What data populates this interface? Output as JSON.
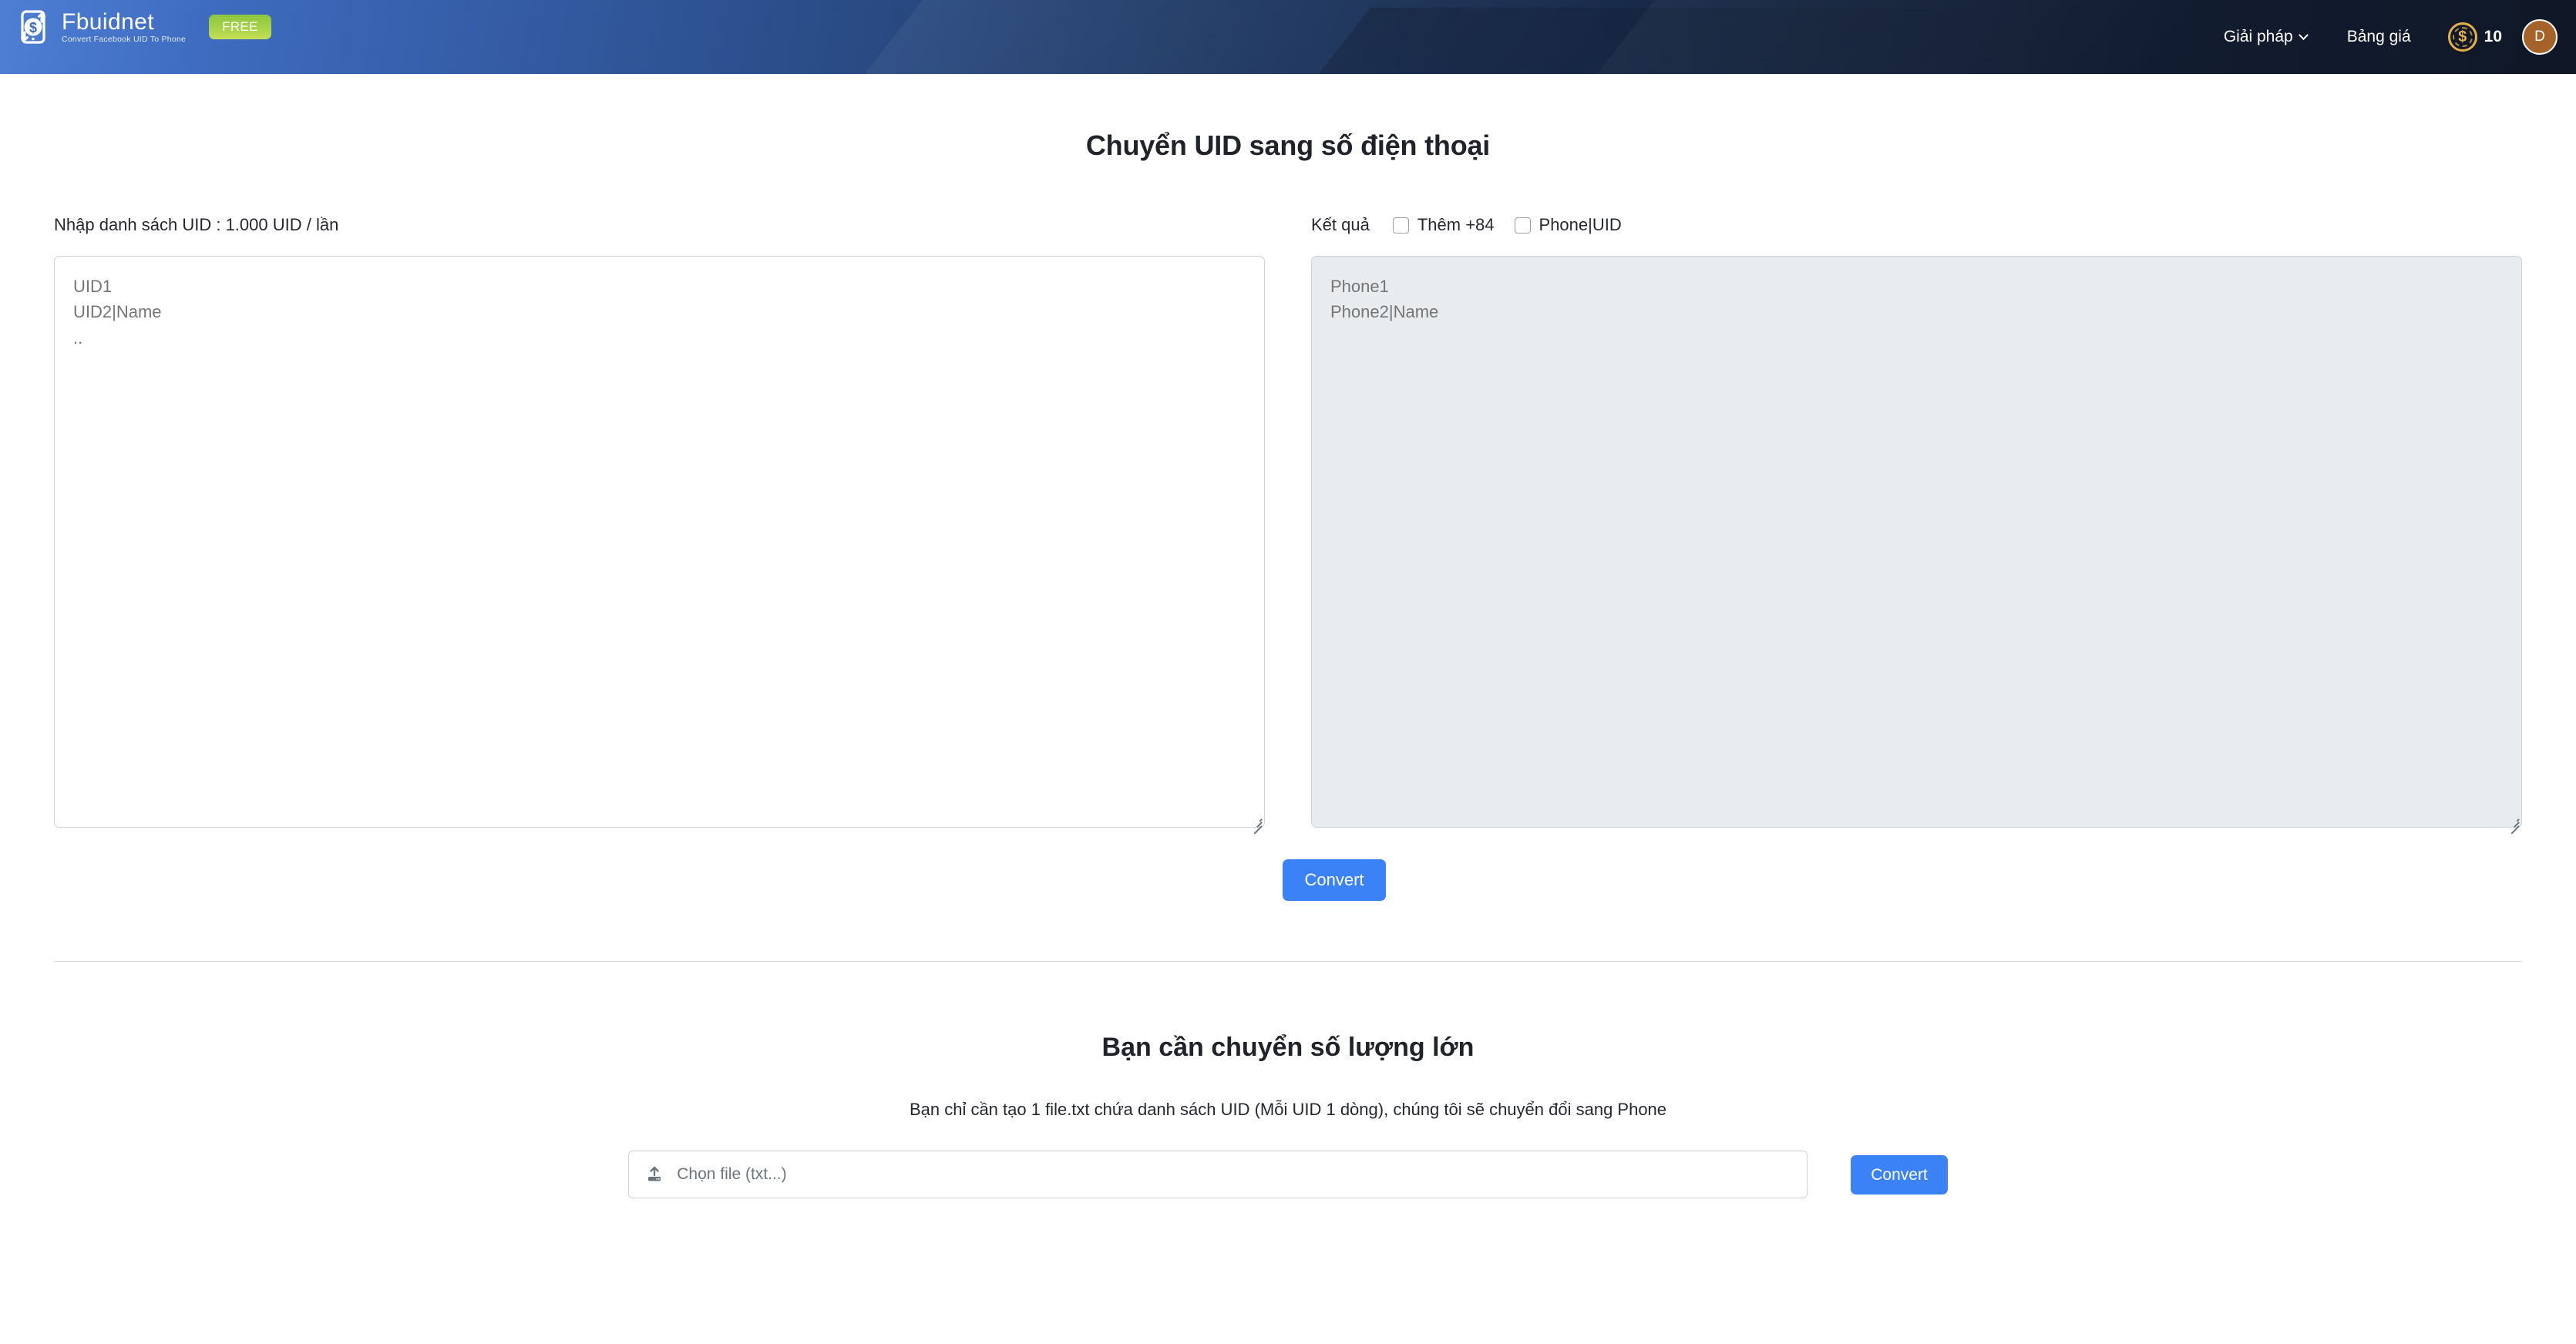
{
  "header": {
    "logo_word": "Fbuidnet",
    "logo_tagline": "Convert Facebook UID To Phone",
    "logo_icon": "dollar-phone-icon",
    "free_badge": "FREE",
    "nav": [
      {
        "label": "Giải pháp",
        "has_caret": true
      },
      {
        "label": "Bảng giá",
        "has_caret": false
      }
    ],
    "coin": {
      "icon": "coin-dollar-icon",
      "count": "10"
    },
    "avatar": {
      "initial": "D",
      "color": "#a5632a"
    }
  },
  "main": {
    "page_title": "Chuyển UID sang số điện thoại",
    "input_panel": {
      "label": "Nhập danh sách UID : 1.000 UID / lần",
      "placeholder": "UID1\nUID2|Name\n.."
    },
    "output_panel": {
      "label": "Kết quả",
      "placeholder": "Phone1\nPhone2|Name",
      "options": [
        {
          "label": "Thêm +84",
          "checked": false
        },
        {
          "label": "Phone|UID",
          "checked": false
        }
      ]
    },
    "convert_button": "Convert"
  },
  "bulk": {
    "title": "Bạn cần chuyển số lượng lớn",
    "description": "Bạn chỉ cần tạo 1 file.txt chứa danh sách UID (Mỗi UID 1 dòng), chúng tôi sẽ chuyển đổi sang Phone",
    "file_placeholder": "Chọn file (txt...)",
    "file_icon": "upload-icon",
    "convert_button": "Convert"
  },
  "colors": {
    "accent_blue": "#3b82f6",
    "badge_green": "#8cc63f",
    "coin_gold": "#e8b04b",
    "avatar_brown": "#a5632a",
    "header_dark": "#101827"
  }
}
